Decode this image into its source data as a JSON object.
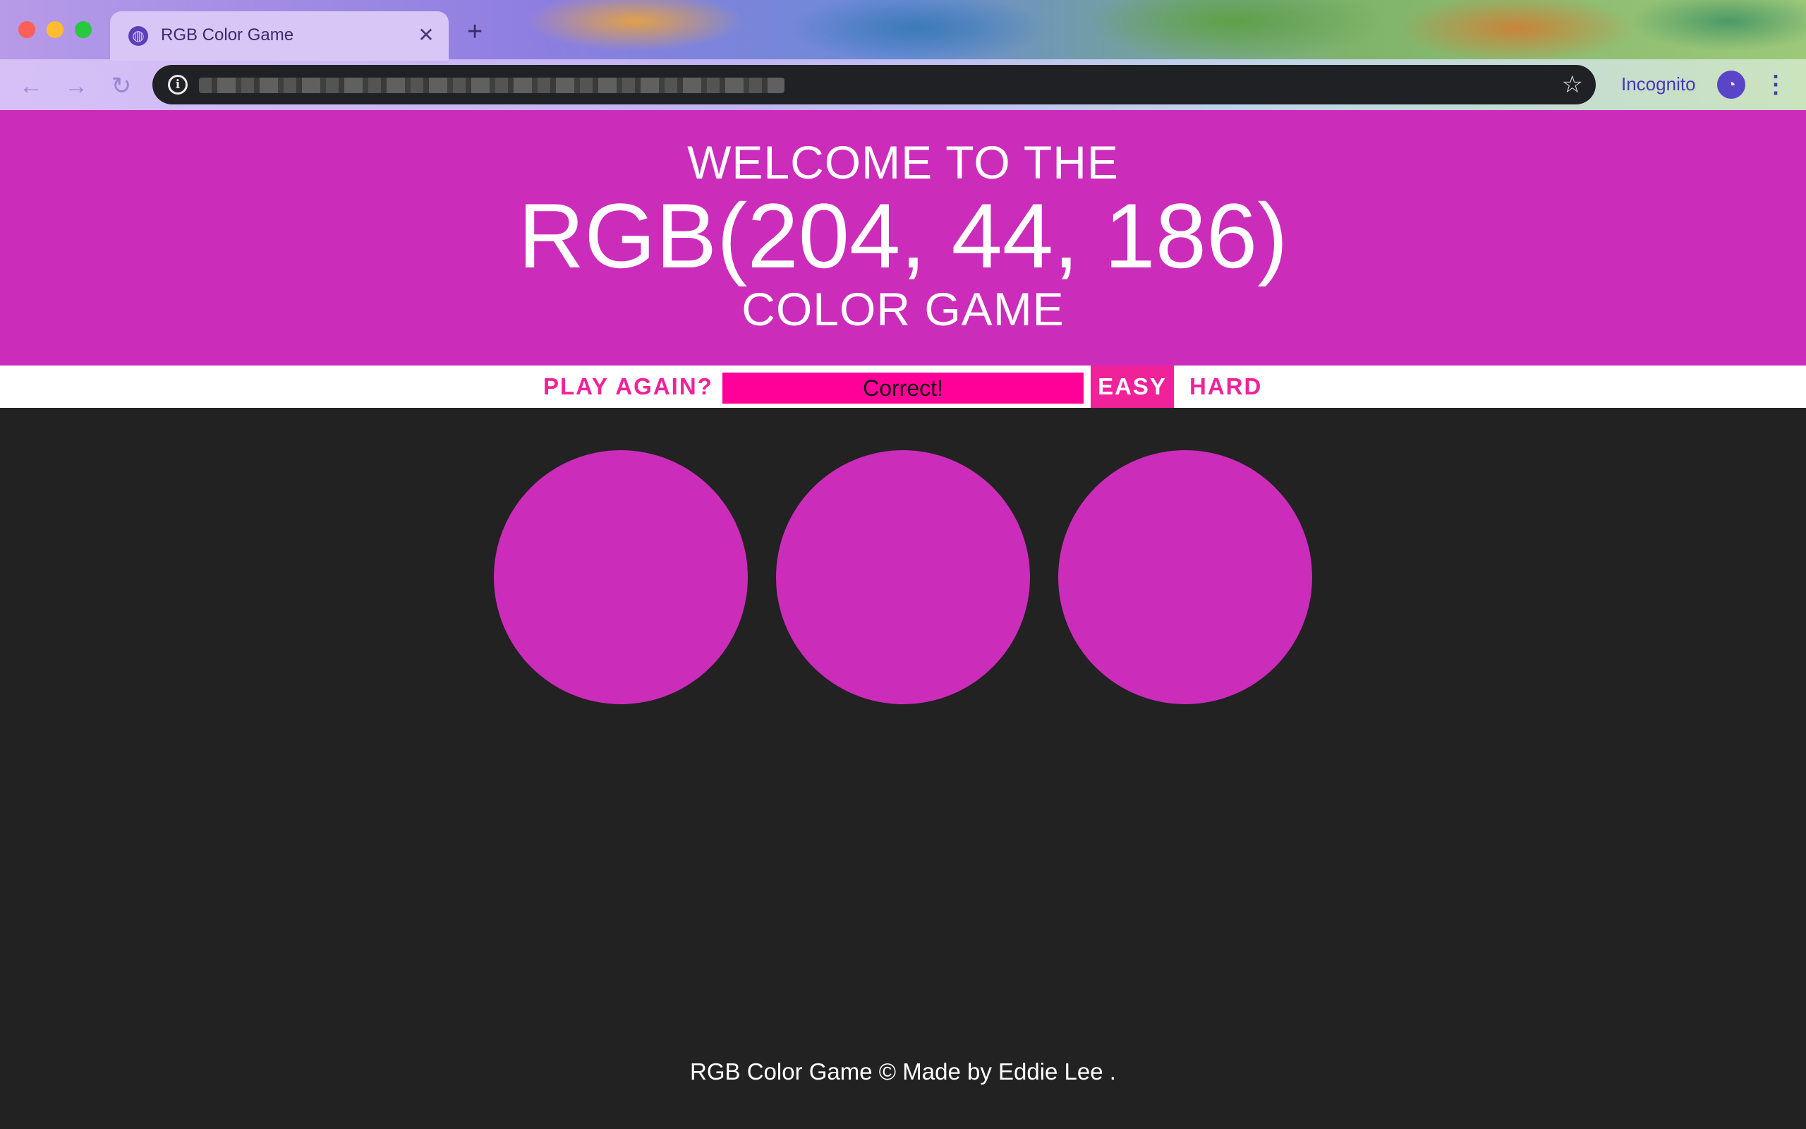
{
  "browser": {
    "tab_title": "RGB Color Game",
    "new_tab_symbol": "+",
    "close_symbol": "✕",
    "incognito_label": "Incognito"
  },
  "colors": {
    "header_bg": "#cc2cba",
    "accent": "#f0229a",
    "message_bg": "#ff0099",
    "page_bg": "#222222",
    "square_color": "#cc2cba"
  },
  "header": {
    "line1": "WELCOME TO THE",
    "rgb": "RGB(204, 44, 186)",
    "line3": "COLOR GAME"
  },
  "controls": {
    "play_again": "PLAY AGAIN?",
    "message": "Correct!",
    "easy": "EASY",
    "hard": "HARD",
    "selected_mode": "EASY"
  },
  "squares": [
    {
      "color": "#cc2cba"
    },
    {
      "color": "#cc2cba"
    },
    {
      "color": "#cc2cba"
    }
  ],
  "footer": {
    "text": "RGB Color Game © Made by Eddie Lee ."
  }
}
